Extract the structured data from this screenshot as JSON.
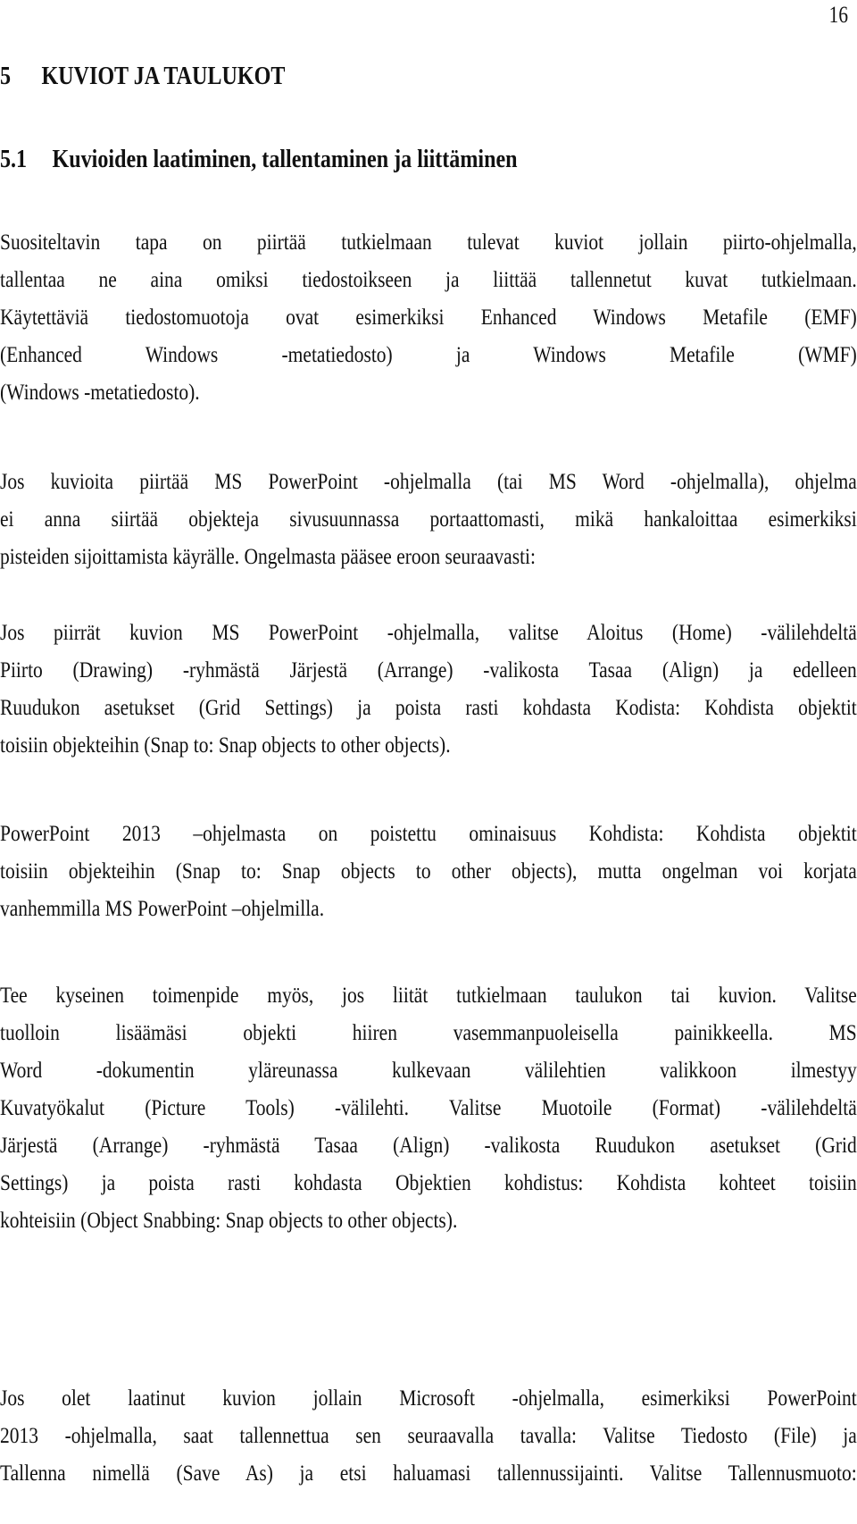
{
  "page_number": "16",
  "chapter": {
    "number": "5",
    "title": "KUVIOT JA TAULUKOT"
  },
  "section": {
    "number": "5.1",
    "title": "Kuvioiden laatiminen, tallentaminen ja liittäminen"
  },
  "paragraphs": [
    {
      "lines": [
        "Suositeltavin tapa on piirtää tutkielmaan tulevat kuviot jollain piirto-ohjelmalla,",
        "tallentaa ne aina omiksi tiedostoikseen ja liittää tallennetut kuvat tutkielmaan.",
        "Käytettäviä tiedostomuotoja ovat esimerkiksi Enhanced Windows Metafile (EMF)",
        "(Enhanced Windows -metatiedosto) ja Windows Metafile (WMF)",
        "(Windows -metatiedosto)."
      ]
    },
    {
      "lines": [
        "Jos kuvioita piirtää MS PowerPoint -ohjelmalla (tai MS Word -ohjelmalla), ohjelma",
        "ei anna siirtää objekteja sivusuunnassa portaattomasti, mikä hankaloittaa esimerkiksi",
        "pisteiden sijoittamista käyrälle. Ongelmasta pääsee eroon seuraavasti:"
      ]
    },
    {
      "lines": [
        "Jos piirrät kuvion MS PowerPoint -ohjelmalla, valitse Aloitus (Home) -välilehdeltä",
        "Piirto (Drawing) -ryhmästä Järjestä (Arrange) -valikosta Tasaa (Align) ja edelleen",
        "Ruudukon asetukset (Grid Settings) ja poista rasti kohdasta Kodista: Kohdista objektit",
        "toisiin objekteihin (Snap to: Snap objects to other objects)."
      ]
    },
    {
      "lines": [
        "PowerPoint 2013 –ohjelmasta on poistettu ominaisuus Kohdista: Kohdista objektit",
        "toisiin objekteihin (Snap to: Snap objects to other objects), mutta ongelman voi korjata",
        "vanhemmilla MS PowerPoint –ohjelmilla."
      ]
    },
    {
      "lines": [
        "Tee kyseinen toimenpide myös, jos liität tutkielmaan taulukon tai kuvion. Valitse",
        "tuolloin lisäämäsi objekti hiiren vasemmanpuoleisella painikkeella. MS",
        "Word -dokumentin yläreunassa kulkevaan välilehtien valikkoon ilmestyy",
        "Kuvatyökalut (Picture Tools) -välilehti. Valitse Muotoile (Format) -välilehdeltä",
        "Järjestä (Arrange) -ryhmästä Tasaa (Align) -valikosta Ruudukon asetukset (Grid",
        "Settings) ja poista rasti kohdasta Objektien kohdistus: Kohdista kohteet toisiin",
        "kohteisiin (Object Snabbing: Snap objects to other objects)."
      ]
    },
    {
      "lines": [
        "Jos olet laatinut kuvion jollain Microsoft -ohjelmalla, esimerkiksi PowerPoint",
        "2013 -ohjelmalla, saat tallennettua sen seuraavalla tavalla: Valitse Tiedosto (File) ja",
        "Tallenna nimellä (Save As) ja etsi haluamasi tallennussijainti. Valitse Tallennusmuoto:"
      ]
    }
  ]
}
